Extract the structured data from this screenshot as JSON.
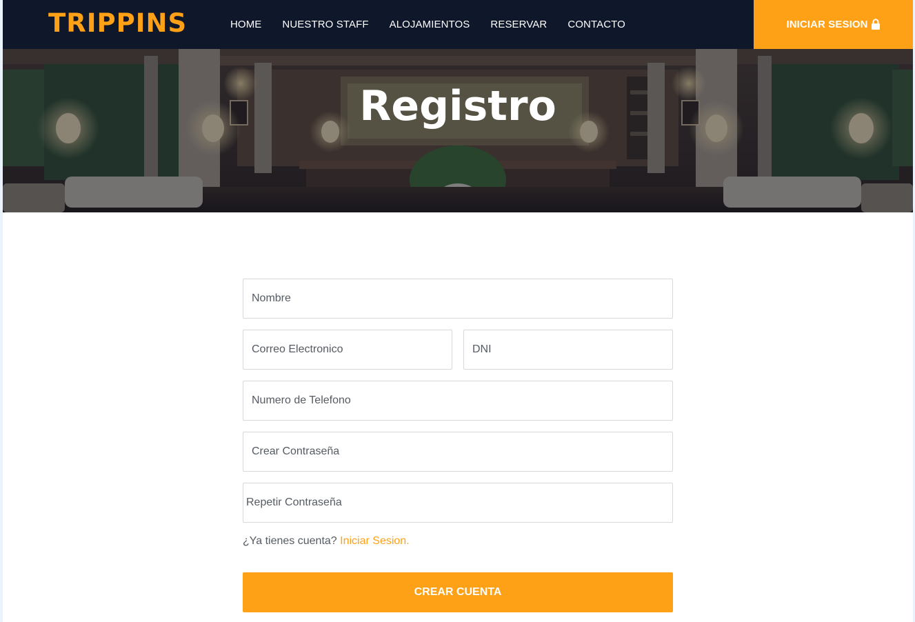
{
  "brand": "TRIPPINS",
  "nav": {
    "items": [
      "HOME",
      "NUESTRO STAFF",
      "ALOJAMIENTOS",
      "RESERVAR",
      "CONTACTO"
    ],
    "login_label": "INICIAR SESION"
  },
  "hero": {
    "title": "Registro"
  },
  "form": {
    "nombre_placeholder": "Nombre",
    "correo_placeholder": "Correo Electronico",
    "dni_placeholder": "DNI",
    "telefono_placeholder": "Numero de Telefono",
    "contrasena_placeholder": "Crear Contraseña",
    "repetir_placeholder": "Repetir Contraseña",
    "account_prompt": "¿Ya tienes cuenta?",
    "account_link": "Iniciar Sesion.",
    "submit_label": "CREAR CUENTA"
  },
  "colors": {
    "accent": "#fea116",
    "navbar": "#0f172b"
  },
  "icons": {
    "login": "lock-icon"
  }
}
